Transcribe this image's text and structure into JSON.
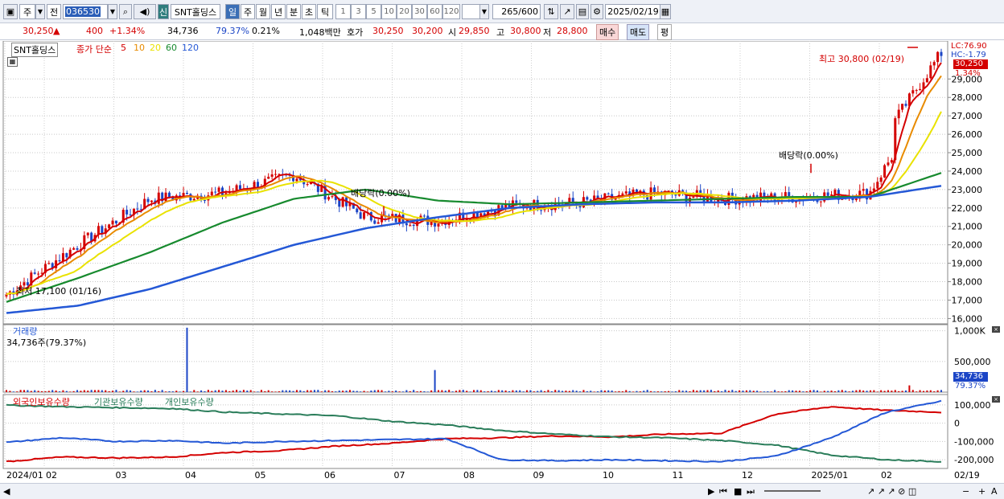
{
  "toolbar": {
    "market": "주",
    "prev": "전",
    "code": "036530",
    "name": "SNT홀딩스",
    "sin": "신",
    "periods": [
      "일",
      "주",
      "월",
      "년",
      "분",
      "초",
      "틱"
    ],
    "active_period": "일",
    "minute_steps": [
      "1",
      "3",
      "5",
      "10",
      "20",
      "30",
      "60",
      "120"
    ],
    "count": "265",
    "count_total": "/600",
    "date": "2025/02/19"
  },
  "quote": {
    "price": "30,250",
    "arrow": "▲",
    "change": "400",
    "change_pct": "+1.34%",
    "volume": "34,736",
    "vol_ratio": "79.37%",
    "turnover": "0.21%",
    "amount": "1,048백만",
    "hoga_label": "호가",
    "ask": "30,250",
    "bid": "30,200",
    "open_label": "시",
    "open": "29,850",
    "high_label": "고",
    "high": "30,800",
    "low_label": "저",
    "low": "28,800",
    "buy": "매수",
    "sell": "매도",
    "avg": "평"
  },
  "legend": {
    "name": "SNT홀딩스",
    "ma_label": "종가 단순",
    "ma_periods": [
      "5",
      "10",
      "20",
      "60",
      "120"
    ],
    "ma_colors": [
      "#d40000",
      "#e88b00",
      "#e9e200",
      "#178a2e",
      "#2458d6"
    ],
    "volume_label": "거래량",
    "volume_value": "34,736주(79.37%)",
    "holdings_foreign": "외국인보유수량",
    "holdings_inst": "기관보유수량",
    "holdings_indiv": "개인보유수량"
  },
  "annotations": {
    "high": "최고 30,800 (02/19)",
    "low": "최저 17,100 (01/16)",
    "div1": "배당락(0.00%)",
    "div2": "배당락(0.00%)"
  },
  "right_axis": {
    "lc": "LC:76.90",
    "hc": "HC:-1.79",
    "price_tag": "30,250",
    "pct_tag": "1.34%",
    "price_ticks": [
      "29,000",
      "28,000",
      "27,000",
      "26,000",
      "25,000",
      "24,000",
      "23,000",
      "22,000",
      "21,000",
      "20,000",
      "19,000",
      "18,000",
      "17,000",
      "16,000"
    ],
    "volume_ticks": [
      "1,000K",
      "500,000"
    ],
    "volume_tag": "34,736",
    "volume_pct": "79.37%",
    "holding_ticks": [
      "100,000",
      "0",
      "-100,000",
      "-200,000"
    ]
  },
  "x_axis": [
    "2024/01",
    "02",
    "03",
    "04",
    "05",
    "06",
    "07",
    "08",
    "09",
    "10",
    "11",
    "12",
    "2025/01",
    "02"
  ],
  "x_axis_end": "02/19",
  "colors": {
    "up": "#d40000",
    "down": "#1b45c6",
    "ma5": "#d40000",
    "ma10": "#e88b00",
    "ma20": "#e9e200",
    "ma60": "#178a2e",
    "ma120": "#2458d6",
    "foreign": "#d40000",
    "inst": "#2a7d5a",
    "indiv": "#2458d6"
  },
  "chart_data": {
    "type": "line",
    "title": "SNT홀딩스",
    "x": [
      "2024/01",
      "02",
      "03",
      "04",
      "05",
      "06",
      "07",
      "08",
      "09",
      "10",
      "11",
      "12",
      "2025/01",
      "02"
    ],
    "series": [
      {
        "name": "5",
        "values": [
          17300,
          20000,
          22500,
          22800,
          23800,
          21500,
          21300,
          22100,
          22300,
          22800,
          22500,
          22600,
          22800,
          29200
        ]
      },
      {
        "name": "60",
        "values": [
          16900,
          18200,
          19600,
          21200,
          22500,
          23000,
          22400,
          22200,
          22300,
          22400,
          22500,
          22600,
          22600,
          23900
        ]
      },
      {
        "name": "120",
        "values": [
          16300,
          16700,
          17600,
          18800,
          20000,
          20900,
          21500,
          22000,
          22200,
          22300,
          22300,
          22400,
          22600,
          23200
        ]
      }
    ],
    "ylim": [
      15800,
      30800
    ],
    "yticks": [
      16000,
      17000,
      18000,
      19000,
      20000,
      21000,
      22000,
      23000,
      24000,
      25000,
      26000,
      27000,
      28000,
      29000
    ],
    "high": 30800,
    "low": 17100,
    "last": 30250
  }
}
